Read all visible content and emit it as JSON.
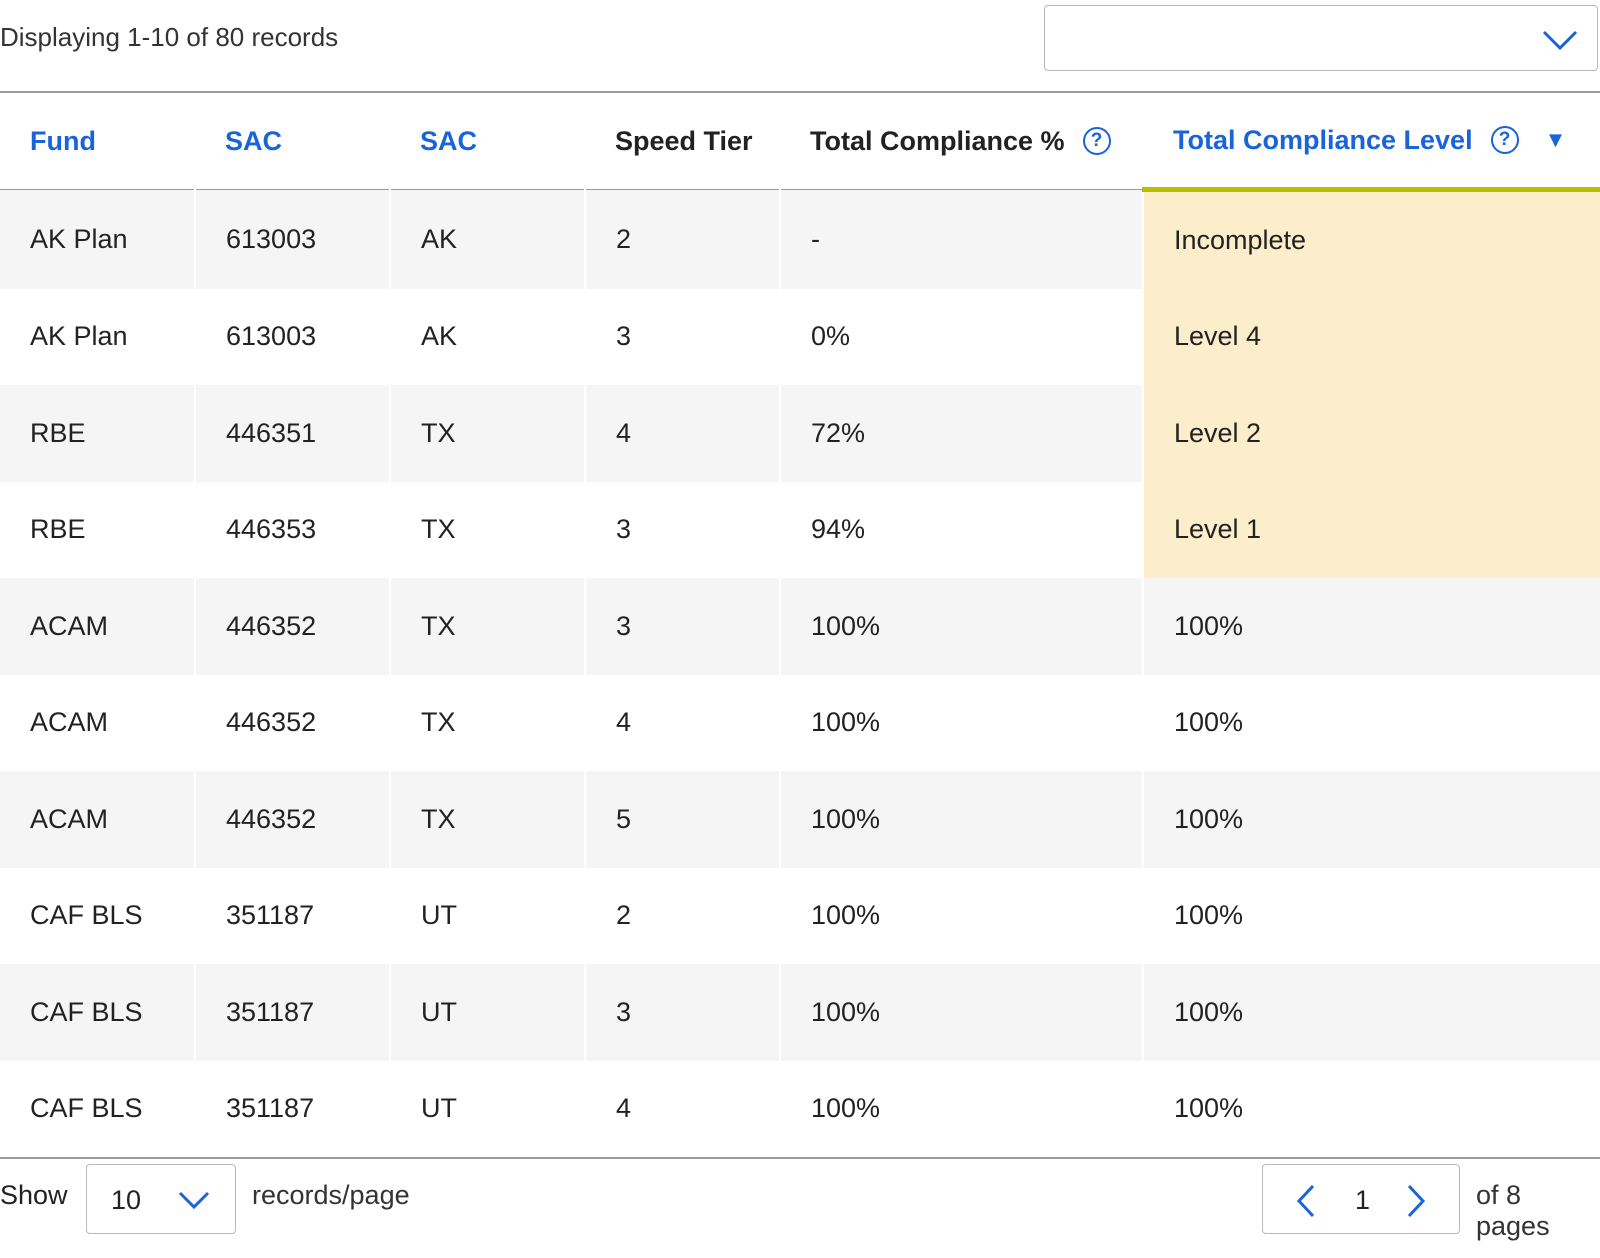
{
  "header": {
    "display_count": "Displaying 1-10 of 80 records",
    "select_value": "",
    "chevron_icon": "chevron-down-icon"
  },
  "table": {
    "columns": [
      {
        "label": "Fund",
        "sortable": true
      },
      {
        "label": "SAC",
        "sortable": true
      },
      {
        "label": "SAC",
        "sortable": true
      },
      {
        "label": "Speed Tier",
        "sortable": false
      },
      {
        "label": "Total Compliance %",
        "sortable": false,
        "help": "?"
      },
      {
        "label": "Total Compliance Level",
        "sortable": true,
        "help": "?",
        "sort_indicator": "▼",
        "sorted": "descending"
      }
    ],
    "rows": [
      [
        "AK Plan",
        "613003",
        "AK",
        "2",
        "-",
        "Incomplete"
      ],
      [
        "AK Plan",
        "613003",
        "AK",
        "3",
        "0%",
        "Level 4"
      ],
      [
        "RBE",
        "446351",
        "TX",
        "4",
        "72%",
        "Level 2"
      ],
      [
        "RBE",
        "446353",
        "TX",
        "3",
        "94%",
        "Level 1"
      ],
      [
        "ACAM",
        "446352",
        "TX",
        "3",
        "100%",
        "100%"
      ],
      [
        "ACAM",
        "446352",
        "TX",
        "4",
        "100%",
        "100%"
      ],
      [
        "ACAM",
        "446352",
        "TX",
        "5",
        "100%",
        "100%"
      ],
      [
        "CAF BLS",
        "351187",
        "UT",
        "2",
        "100%",
        "100%"
      ],
      [
        "CAF BLS",
        "351187",
        "UT",
        "3",
        "100%",
        "100%"
      ],
      [
        "CAF BLS",
        "351187",
        "UT",
        "4",
        "100%",
        "100%"
      ]
    ]
  },
  "footer": {
    "show_label": "Show",
    "page_size": "10",
    "records_label": "records/page",
    "current_page": "1",
    "of_pages": "of 8 pages"
  },
  "colors": {
    "link_blue": "#1a64d9",
    "sort_underline": "#b8bd00",
    "highlight_bg": "#fcedcb",
    "stripe_bg": "#f5f5f5"
  }
}
